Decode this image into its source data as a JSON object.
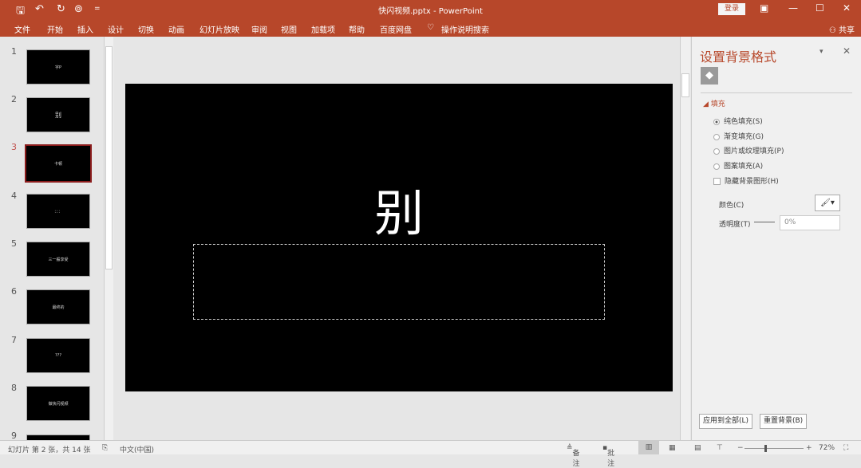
{
  "qat": {
    "save": "🖫",
    "undo": "↶",
    "redo": "↻",
    "present": "⊚",
    "more": "="
  },
  "title": "快闪视频.pptx  -  PowerPoint",
  "window": {
    "login": "登录",
    "ribbon_display": "▣",
    "minimize": "—",
    "maximize": "☐",
    "close": "✕"
  },
  "tabs": [
    "文件",
    "开始",
    "插入",
    "设计",
    "切换",
    "动画",
    "幻灯片放映",
    "审阅",
    "视图",
    "加载项",
    "帮助",
    "百度网盘"
  ],
  "tell_me": "操作说明搜索",
  "share": "共享",
  "slides": [
    {
      "n": "1",
      "text": "字P"
    },
    {
      "n": "2",
      "text": "别"
    },
    {
      "n": "3",
      "text": "卡顿"
    },
    {
      "n": "4",
      "text": "：：："
    },
    {
      "n": "5",
      "text": "三一般享受"
    },
    {
      "n": "6",
      "text": "最终的"
    },
    {
      "n": "7",
      "text": "???"
    },
    {
      "n": "8",
      "text": "做快闪视频"
    },
    {
      "n": "9",
      "text": ""
    }
  ],
  "current_slide": {
    "title": "别"
  },
  "pane": {
    "title": "设置背景格式",
    "section": "填充",
    "options": [
      {
        "label": "纯色填充(S)",
        "selected": true
      },
      {
        "label": "渐变填充(G)",
        "selected": false
      },
      {
        "label": "图片或纹理填充(P)",
        "selected": false
      },
      {
        "label": "图案填充(A)",
        "selected": false
      }
    ],
    "hide_bg": "隐藏背景图形(H)",
    "color_label": "颜色(C)",
    "transparency_label": "透明度(T)",
    "transparency_value": "0%",
    "apply_all": "应用到全部(L)",
    "reset": "重置背景(B)"
  },
  "status": {
    "slide_info": "幻灯片 第 2 张，共 14 张",
    "language": "中文(中国)",
    "notes": "备注",
    "comments": "批注",
    "zoom": "72%"
  },
  "colors": {
    "accent": "#b7472a"
  }
}
